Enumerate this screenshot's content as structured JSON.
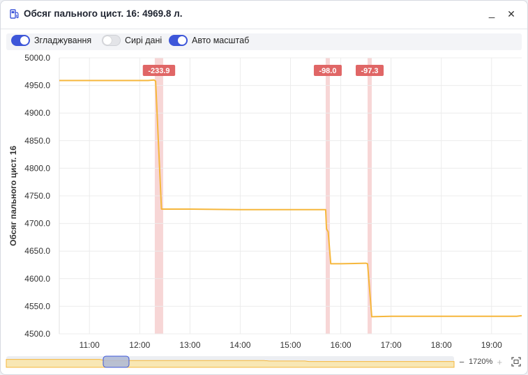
{
  "window": {
    "title": "Обсяг пального цист. 16: 4969.8 л.",
    "title_icon": "fuel-pump-icon",
    "minimize_label": "_",
    "close_label": "✕"
  },
  "toolbar": {
    "toggles": [
      {
        "label": "Згладжування",
        "on": true
      },
      {
        "label": "Сирі дані",
        "on": false
      },
      {
        "label": "Авто масштаб",
        "on": true
      }
    ]
  },
  "zoom": {
    "minus_label": "−",
    "value": "1720%",
    "plus_label": "+",
    "fit_icon": "fit-screen-icon"
  },
  "colors": {
    "line": "#f6b73c",
    "event_band": "#f7d6d6",
    "event_label_bg": "#e06666",
    "accent": "#3d56d9"
  },
  "chart_data": {
    "type": "line",
    "ylabel": "Обсяг пального цист. 16",
    "ylim": [
      4500,
      5000
    ],
    "xlim": [
      "10:24",
      "19:36"
    ],
    "yticks": [
      "5000.0",
      "4950.0",
      "4900.0",
      "4850.0",
      "4800.0",
      "4750.0",
      "4700.0",
      "4650.0",
      "4600.0",
      "4550.0",
      "4500.0"
    ],
    "xticks": [
      "11:00",
      "12:00",
      "13:00",
      "14:00",
      "15:00",
      "16:00",
      "17:00",
      "18:00",
      "19:00"
    ],
    "grid": true,
    "series": [
      {
        "x": [
          "10:24",
          "11:30",
          "12:10",
          "12:17",
          "12:19",
          "12:26",
          "13:00",
          "14:00",
          "15:00",
          "15:42",
          "15:43",
          "15:45",
          "15:48",
          "16:00",
          "16:30",
          "16:32",
          "16:37",
          "17:00",
          "18:00",
          "19:00",
          "19:30",
          "19:36"
        ],
        "y": [
          4959,
          4959,
          4959,
          4960,
          4958,
          4726,
          4726,
          4725,
          4725,
          4725,
          4690,
          4685,
          4627,
          4627,
          4628,
          4627,
          4531,
          4532,
          4532,
          4532,
          4532,
          4533
        ]
      }
    ],
    "events": [
      {
        "label": "-233.9",
        "start": "12:18",
        "end": "12:28"
      },
      {
        "label": "-98.0",
        "start": "15:42",
        "end": "15:47"
      },
      {
        "label": "-97.3",
        "start": "16:32",
        "end": "16:37"
      }
    ]
  }
}
